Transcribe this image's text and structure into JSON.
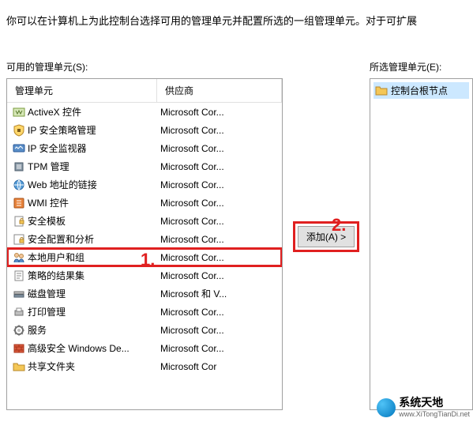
{
  "description": "你可以在计算机上为此控制台选择可用的管理单元并配置所选的一组管理单元。对于可扩展",
  "labels": {
    "available": "可用的管理单元(S):",
    "selected": "所选管理单元(E):"
  },
  "columns": {
    "name": "管理单元",
    "vendor": "供应商"
  },
  "buttons": {
    "add": "添加(A) >"
  },
  "tree": {
    "root": "控制台根节点"
  },
  "annotations": {
    "step1": "1.",
    "step2": "2."
  },
  "snapins": [
    {
      "name": "ActiveX 控件",
      "vendor": "Microsoft Cor...",
      "icon": "activex"
    },
    {
      "name": "IP 安全策略管理",
      "vendor": "Microsoft Cor...",
      "icon": "ipsec-policy"
    },
    {
      "name": "IP 安全监视器",
      "vendor": "Microsoft Cor...",
      "icon": "ipsec-monitor"
    },
    {
      "name": "TPM 管理",
      "vendor": "Microsoft Cor...",
      "icon": "tpm"
    },
    {
      "name": "Web 地址的链接",
      "vendor": "Microsoft Cor...",
      "icon": "web-link"
    },
    {
      "name": "WMI 控件",
      "vendor": "Microsoft Cor...",
      "icon": "wmi"
    },
    {
      "name": "安全模板",
      "vendor": "Microsoft Cor...",
      "icon": "sec-template"
    },
    {
      "name": "安全配置和分析",
      "vendor": "Microsoft Cor...",
      "icon": "sec-config"
    },
    {
      "name": "本地用户和组",
      "vendor": "Microsoft Cor...",
      "icon": "users-groups",
      "highlight": true
    },
    {
      "name": "策略的结果集",
      "vendor": "Microsoft Cor...",
      "icon": "rsop"
    },
    {
      "name": "磁盘管理",
      "vendor": "Microsoft 和 V...",
      "icon": "disk-mgmt"
    },
    {
      "name": "打印管理",
      "vendor": "Microsoft Cor...",
      "icon": "print-mgmt"
    },
    {
      "name": "服务",
      "vendor": "Microsoft Cor...",
      "icon": "services"
    },
    {
      "name": "高级安全 Windows De...",
      "vendor": "Microsoft Cor...",
      "icon": "firewall"
    },
    {
      "name": "共享文件夹",
      "vendor": "Microsoft Cor",
      "icon": "shared-folders"
    }
  ],
  "watermark": {
    "title": "系统天地",
    "url": "www.XiTongTianDi.net"
  }
}
